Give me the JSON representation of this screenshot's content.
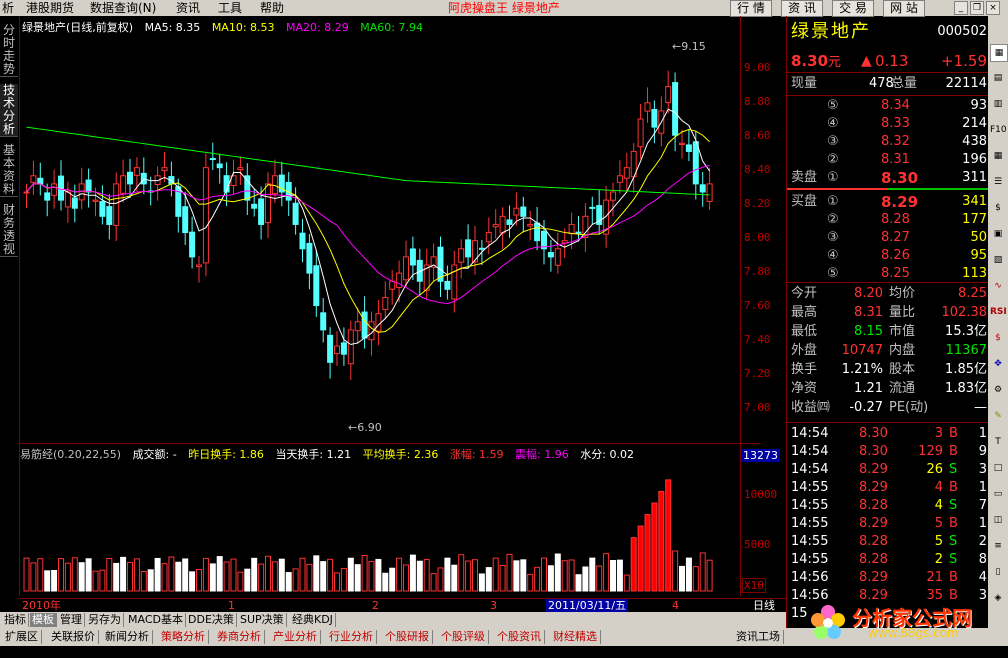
{
  "menu": {
    "items": [
      "析",
      "港股期货",
      "数据查询(N)",
      "资讯",
      "工具",
      "帮助"
    ],
    "app_title": "阿虎操盘王  绿景地产",
    "buttons": [
      "行 情",
      "资 讯",
      "交 易",
      "网 站"
    ]
  },
  "left_tabs": [
    "分时走势",
    "技术分析",
    "基本资料",
    "财务透视"
  ],
  "price_legend": {
    "title": "绿景地产(日线,前复权)",
    "ma5": "MA5: 8.35",
    "ma10": "MA10: 8.53",
    "ma20": "MA20: 8.29",
    "ma60": "MA60: 7.94"
  },
  "price_axis": [
    "9.00",
    "8.80",
    "8.60",
    "8.40",
    "8.20",
    "8.00",
    "7.80",
    "7.60",
    "7.40",
    "7.20",
    "7.00"
  ],
  "high_label": "9.15",
  "low_label": "6.90",
  "vol_legend": {
    "title": "易筋经(0.20,22,55)",
    "amount": "成交额: -",
    "prev_turnover": "昨日换手: 1.86",
    "cur_turnover": "当天换手: 1.21",
    "avg_turnover": "平均换手: 2.36",
    "rise": "涨幅: 1.59",
    "amp": "震幅: 1.96",
    "water": "水分: 0.02"
  },
  "vol_axis": {
    "top": "13273",
    "labels": [
      "10000",
      "5000"
    ],
    "unit": "X10"
  },
  "date_axis": {
    "year": "2010年",
    "m1": "1",
    "m2": "2",
    "m3": "3",
    "selected": "2011/03/11/五",
    "m4": "4",
    "period": "日线"
  },
  "bottom_tabs1": [
    "指标",
    "模板",
    "管理",
    "另存为",
    "MACD基本",
    "DDE决策",
    "SUP决策",
    "经典KDJ"
  ],
  "bottom_tabs2": [
    "扩展区",
    "关联报价",
    "新闻分析",
    "策略分析",
    "券商分析",
    "产业分析",
    "行业分析",
    "个股研报",
    "个股评级",
    "个股资讯",
    "财经精选",
    "资讯工场"
  ],
  "quote": {
    "name": "绿景地产",
    "code": "000502",
    "price": "8.30",
    "unit": "元",
    "change": "0.13",
    "pct": "+1.59",
    "now_vol_label": "现量",
    "now_vol": "478",
    "total_label": "总量",
    "total": "22114",
    "sell": [
      {
        "lvl": "⑤",
        "p": "8.34",
        "v": "93"
      },
      {
        "lvl": "④",
        "p": "8.33",
        "v": "214"
      },
      {
        "lvl": "③",
        "p": "8.32",
        "v": "438"
      },
      {
        "lvl": "②",
        "p": "8.31",
        "v": "196"
      },
      {
        "lvl": "①",
        "p": "8.30",
        "v": "311"
      }
    ],
    "sell_label": "卖盘",
    "buy": [
      {
        "lvl": "①",
        "p": "8.29",
        "v": "341"
      },
      {
        "lvl": "②",
        "p": "8.28",
        "v": "177"
      },
      {
        "lvl": "③",
        "p": "8.27",
        "v": "50"
      },
      {
        "lvl": "④",
        "p": "8.26",
        "v": "95"
      },
      {
        "lvl": "⑤",
        "p": "8.25",
        "v": "113"
      }
    ],
    "buy_label": "买盘",
    "stats": [
      {
        "a": "今开",
        "av": "8.20",
        "b": "均价",
        "bv": "8.25"
      },
      {
        "a": "最高",
        "av": "8.31",
        "b": "量比",
        "bv": "102.38"
      },
      {
        "a": "最低",
        "av": "8.15",
        "b": "市值",
        "bv": "15.3亿"
      },
      {
        "a": "外盘",
        "av": "10747",
        "b": "内盘",
        "bv": "11367"
      },
      {
        "a": "换手",
        "av": "1.21%",
        "b": "股本",
        "bv": "1.85亿"
      },
      {
        "a": "净资",
        "av": "1.21",
        "b": "流通",
        "bv": "1.83亿"
      },
      {
        "a": "收益㈣",
        "av": "-0.27",
        "b": "PE(动)",
        "bv": "—"
      }
    ],
    "ticks": [
      {
        "t": "14:54",
        "p": "8.30",
        "v": "3",
        "s": "B"
      },
      {
        "t": "14:54",
        "p": "8.30",
        "v": "129",
        "s": "B"
      },
      {
        "t": "14:54",
        "p": "8.29",
        "v": "26",
        "s": "S"
      },
      {
        "t": "14:55",
        "p": "8.29",
        "v": "4",
        "s": "B"
      },
      {
        "t": "14:55",
        "p": "8.28",
        "v": "4",
        "s": "S"
      },
      {
        "t": "14:55",
        "p": "8.29",
        "v": "5",
        "s": "B"
      },
      {
        "t": "14:55",
        "p": "8.28",
        "v": "5",
        "s": "S"
      },
      {
        "t": "14:55",
        "p": "8.28",
        "v": "2",
        "s": "S"
      },
      {
        "t": "14:56",
        "p": "8.29",
        "v": "21",
        "s": "B"
      },
      {
        "t": "14:56",
        "p": "8.29",
        "v": "35",
        "s": "B"
      },
      {
        "t": "15",
        "p": "",
        "v": "",
        "s": ""
      }
    ],
    "tick_counts": [
      "1",
      "9",
      "3",
      "1",
      "7",
      "1",
      "2",
      "8",
      "4",
      "3"
    ]
  },
  "watermark": {
    "text": "分析家公式网",
    "url": "www.88gs.com"
  },
  "chart_data": {
    "type": "candlestick",
    "title": "绿景地产(日线,前复权)",
    "ylim": [
      6.9,
      9.15
    ],
    "ma_series": [
      "MA5",
      "MA10",
      "MA20",
      "MA60"
    ],
    "last_close": 8.3,
    "high": 9.15,
    "low": 6.9
  },
  "colors": {
    "up": "#ff3232",
    "down": "#54ffff",
    "ma5": "#ffffff",
    "ma10": "#ffff00",
    "ma20": "#ff00ff",
    "ma60": "#00ff00",
    "frame": "#800000"
  }
}
